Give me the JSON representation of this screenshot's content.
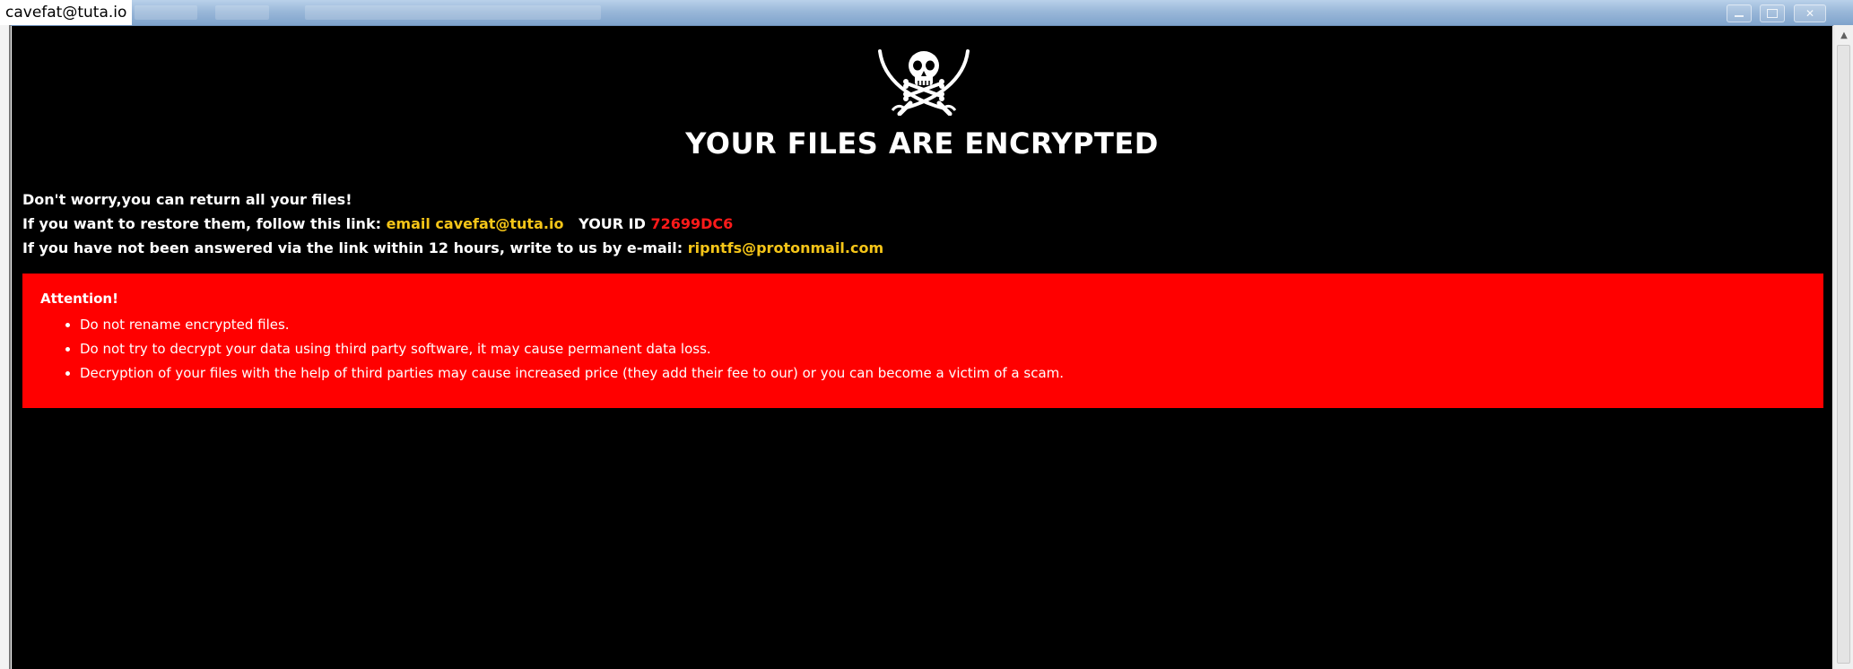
{
  "window": {
    "title": "cavefat@tuta.io"
  },
  "icons": {
    "logo": "skull-and-crossed-swords-icon",
    "minimize": "minimize-icon",
    "maximize": "maximize-icon",
    "close": "close-icon",
    "scroll_up": "chevron-up-icon"
  },
  "colors": {
    "background": "#000000",
    "text": "#ffffff",
    "highlight": "#f5c518",
    "id": "#ff1a1a",
    "attention_bg": "#ff0000"
  },
  "headline": "YOUR FILES ARE ENCRYPTED",
  "message": {
    "line1": "Don't worry,you can return all your files!",
    "line2_prefix": "If you want to restore them, follow this link:",
    "line2_link": "email cavefat@tuta.io",
    "line2_id_label": "YOUR ID",
    "line2_id": "72699DC6",
    "line3_prefix": "If you have not been answered via the link within 12 hours, write to us by e-mail:",
    "line3_email": "ripntfs@protonmail.com"
  },
  "attention": {
    "title": "Attention!",
    "items": [
      "Do not rename encrypted files.",
      "Do not try to decrypt your data using third party software, it may cause permanent data loss.",
      "Decryption of your files with the help of third parties may cause increased price (they add their fee to our) or you can become a victim of a scam."
    ]
  }
}
